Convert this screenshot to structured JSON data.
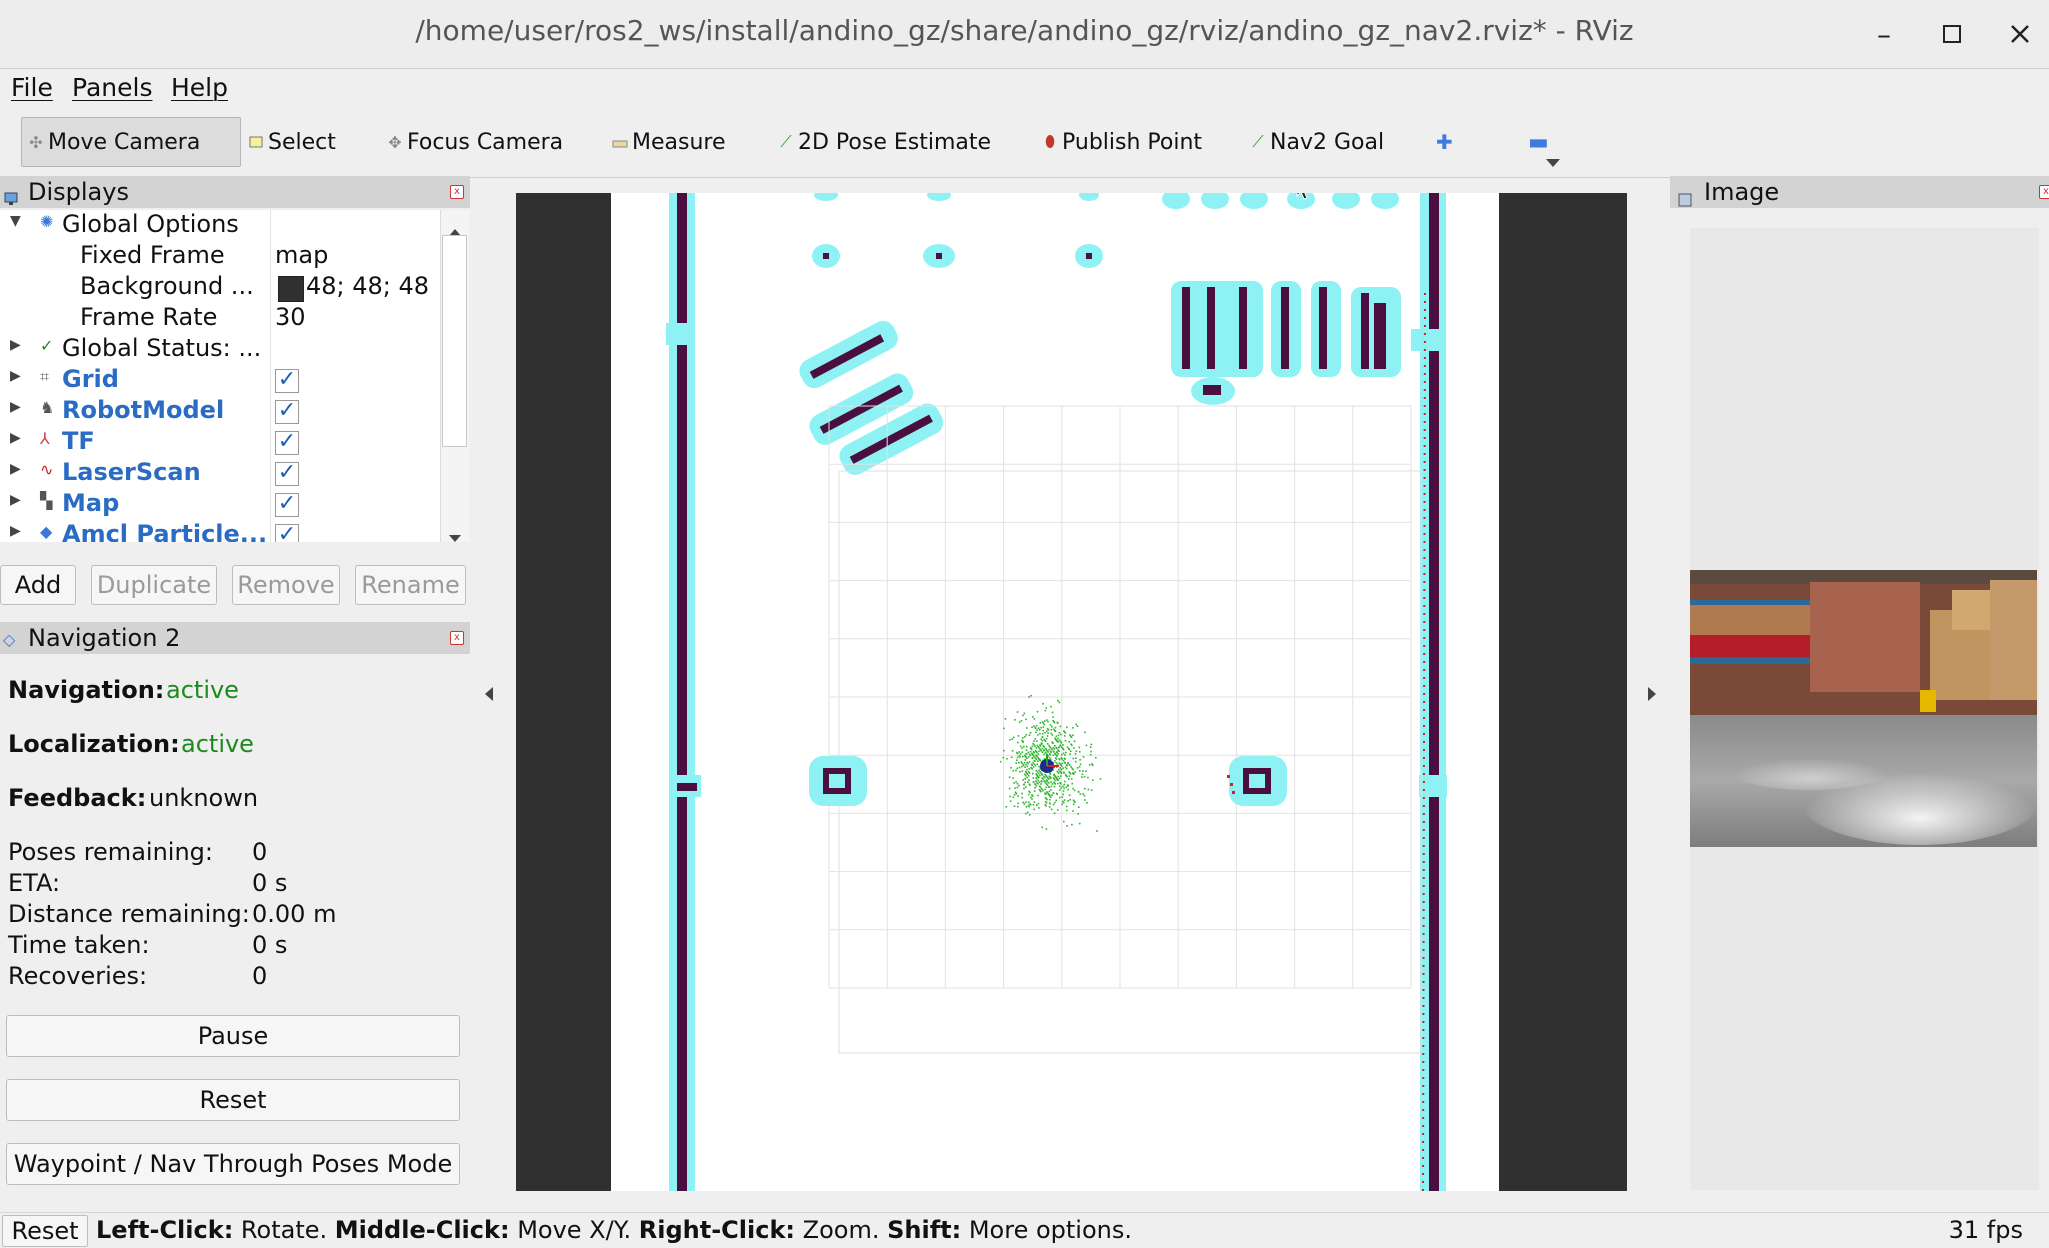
{
  "window": {
    "title": "/home/user/ros2_ws/install/andino_gz/share/andino_gz/rviz/andino_gz_nav2.rviz* - RViz"
  },
  "menu": [
    "File",
    "Panels",
    "Help"
  ],
  "toolbar": {
    "move_camera": "Move Camera",
    "select": "Select",
    "focus_camera": "Focus Camera",
    "measure": "Measure",
    "pose_estimate": "2D Pose Estimate",
    "publish_point": "Publish Point",
    "nav2_goal": "Nav2 Goal"
  },
  "displays": {
    "title": "Displays",
    "global_options": "Global Options",
    "fixed_frame_label": "Fixed Frame",
    "fixed_frame_value": "map",
    "background_label": "Background ...",
    "background_value": "48; 48; 48",
    "frame_rate_label": "Frame Rate",
    "frame_rate_value": "30",
    "global_status": "Global Status: ...",
    "items": [
      {
        "label": "Grid",
        "checked": true
      },
      {
        "label": "RobotModel",
        "checked": true
      },
      {
        "label": "TF",
        "checked": true
      },
      {
        "label": "LaserScan",
        "checked": true
      },
      {
        "label": "Map",
        "checked": true
      },
      {
        "label": "Amcl Particle...",
        "checked": true
      }
    ],
    "buttons": {
      "add": "Add",
      "duplicate": "Duplicate",
      "remove": "Remove",
      "rename": "Rename"
    }
  },
  "nav2": {
    "title": "Navigation 2",
    "navigation_label": "Navigation:",
    "navigation_value": "active",
    "localization_label": "Localization:",
    "localization_value": "active",
    "feedback_label": "Feedback:",
    "feedback_value": "unknown",
    "poses_label": "Poses remaining:",
    "poses_value": "0",
    "eta_label": "ETA:",
    "eta_value": "0 s",
    "distance_label": "Distance remaining:",
    "distance_value": "0.00 m",
    "time_label": "Time taken:",
    "time_value": "0 s",
    "recoveries_label": "Recoveries:",
    "recoveries_value": "0",
    "pause": "Pause",
    "reset": "Reset",
    "waypoint_mode": "Waypoint / Nav Through Poses Mode"
  },
  "image_panel": {
    "title": "Image"
  },
  "statusbar": {
    "reset": "Reset",
    "left_click": "Left-Click:",
    "left_click_desc": " Rotate. ",
    "middle_click": "Middle-Click:",
    "middle_click_desc": " Move X/Y. ",
    "right_click": "Right-Click:",
    "right_click_desc": " Zoom. ",
    "shift": "Shift:",
    "shift_desc": " More options.",
    "fps": "31 fps"
  },
  "colors": {
    "background": "#303030",
    "obstacle": "#4a0f3e",
    "inflation": "#8ef2f5",
    "inflation_edge": "#59a9aa",
    "particles": "#2fb52f",
    "laser": "#d0221e",
    "active_green": "#1d8a1d",
    "display_blue": "#2a6cc4"
  }
}
